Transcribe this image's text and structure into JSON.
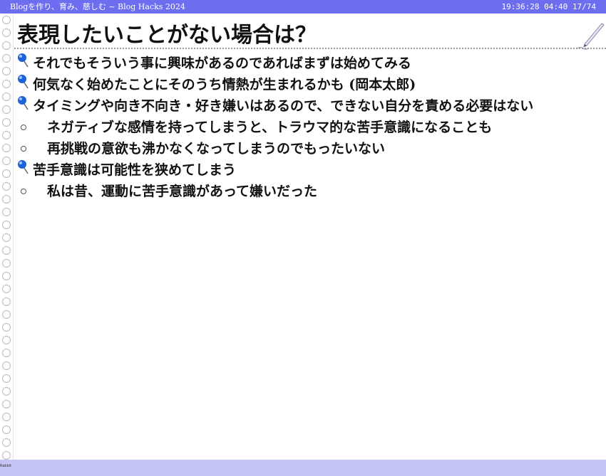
{
  "header": {
    "title": "Blogを作り、育み、慈しむ ~ Blog Hacks 2024",
    "status": "19:36:28 04:40 17/74"
  },
  "slide": {
    "title": "表現したいことがない場合は？",
    "items": [
      {
        "text": "それでもそういう事に興味があるのであればまずは始めてみる"
      },
      {
        "text": "何気なく始めたことにそのうち情熱が生まれるかも (岡本太郎)"
      },
      {
        "text": "タイミングや向き不向き・好き嫌いはあるので、できない自分を責める必要はない"
      },
      {
        "text": "ネガティブな感情を持ってしまうと、トラウマ的な苦手意識になることも"
      },
      {
        "text": "再挑戦の意欲も沸かなくなってしまうのでもったいない"
      },
      {
        "text": "苦手意識は可能性を狭めてしまう"
      },
      {
        "text": "私は昔、運動に苦手意識があって嫌いだった"
      }
    ]
  },
  "footer": {
    "label": "Rabbit"
  },
  "colors": {
    "topbar": "#6d6df0",
    "bottombar": "#c4c4f7",
    "pin": "#1e63d6"
  }
}
